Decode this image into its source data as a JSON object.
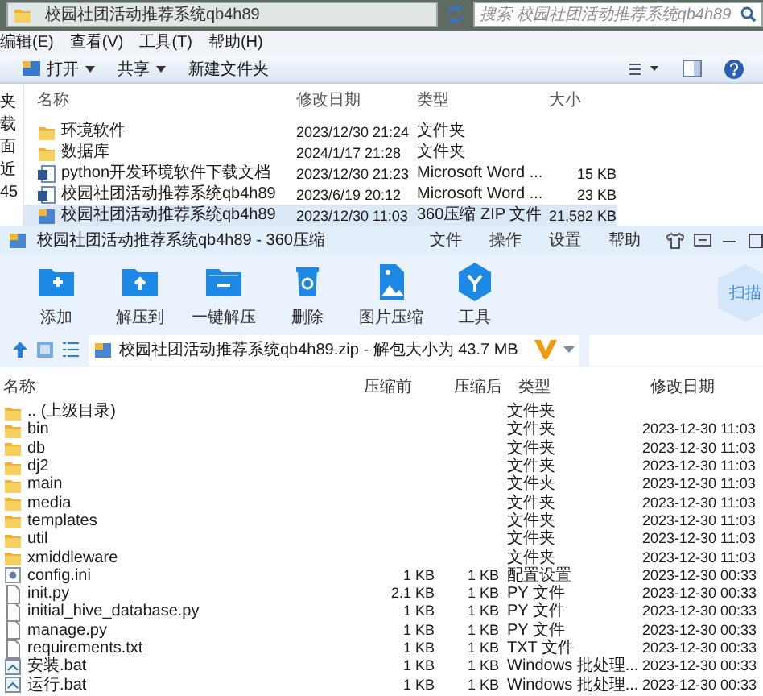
{
  "explorer": {
    "address": {
      "path": "校园社团活动推荐系统qb4h89"
    },
    "search": {
      "placeholder": "搜索 校园社团活动推荐系统qb4h89"
    },
    "menu": [
      "编辑(E)",
      "查看(V)",
      "工具(T)",
      "帮助(H)"
    ],
    "toolbar": [
      {
        "label": "打开",
        "kind": "open"
      },
      {
        "label": "共享",
        "kind": "dropdown"
      },
      {
        "label": "新建文件夹",
        "kind": "plain"
      }
    ],
    "sidebar": [
      "夹",
      "载",
      "面",
      "近",
      "45"
    ],
    "columns": [
      "名称",
      "修改日期",
      "类型",
      "大小"
    ],
    "rows": [
      {
        "name": "环境软件",
        "date": "2023/12/30 21:24",
        "type": "文件夹",
        "size": "",
        "kind": "folder",
        "selected": false
      },
      {
        "name": "数据库",
        "date": "2024/1/17 21:28",
        "type": "文件夹",
        "size": "",
        "kind": "folder",
        "selected": false
      },
      {
        "name": "python开发环境软件下载文档",
        "date": "2023/12/30 21:23",
        "type": "Microsoft Word ...",
        "size": "15 KB",
        "kind": "word",
        "selected": false
      },
      {
        "name": "校园社团活动推荐系统qb4h89",
        "date": "2023/6/19 20:12",
        "type": "Microsoft Word ...",
        "size": "23 KB",
        "kind": "word",
        "selected": false
      },
      {
        "name": "校园社团活动推荐系统qb4h89",
        "date": "2023/12/30 11:03",
        "type": "360压缩 ZIP 文件",
        "size": "21,582 KB",
        "kind": "zip",
        "selected": true
      }
    ]
  },
  "zip": {
    "title": "校园社团活动推荐系统qb4h89 - 360压缩",
    "menu": [
      "文件",
      "操作",
      "设置",
      "帮助"
    ],
    "tools": [
      {
        "label": "添加",
        "kind": "add"
      },
      {
        "label": "解压到",
        "kind": "extract"
      },
      {
        "label": "一键解压",
        "kind": "oneclick"
      },
      {
        "label": "删除",
        "kind": "delete"
      },
      {
        "label": "图片压缩",
        "kind": "image"
      },
      {
        "label": "工具",
        "kind": "tools"
      }
    ],
    "scan": "扫描",
    "path": "校园社团活动推荐系统qb4h89.zip - 解包大小为 43.7 MB",
    "columns": [
      "名称",
      "压缩前",
      "压缩后",
      "类型",
      "修改日期"
    ],
    "rows": [
      {
        "name": ".. (上级目录)",
        "before": "",
        "after": "",
        "type": "文件夹",
        "date": "",
        "kind": "folder"
      },
      {
        "name": "bin",
        "before": "",
        "after": "",
        "type": "文件夹",
        "date": "2023-12-30 11:03",
        "kind": "folder"
      },
      {
        "name": "db",
        "before": "",
        "after": "",
        "type": "文件夹",
        "date": "2023-12-30 11:03",
        "kind": "folder"
      },
      {
        "name": "dj2",
        "before": "",
        "after": "",
        "type": "文件夹",
        "date": "2023-12-30 11:03",
        "kind": "folder"
      },
      {
        "name": "main",
        "before": "",
        "after": "",
        "type": "文件夹",
        "date": "2023-12-30 11:03",
        "kind": "folder"
      },
      {
        "name": "media",
        "before": "",
        "after": "",
        "type": "文件夹",
        "date": "2023-12-30 11:03",
        "kind": "folder"
      },
      {
        "name": "templates",
        "before": "",
        "after": "",
        "type": "文件夹",
        "date": "2023-12-30 11:03",
        "kind": "folder"
      },
      {
        "name": "util",
        "before": "",
        "after": "",
        "type": "文件夹",
        "date": "2023-12-30 11:03",
        "kind": "folder"
      },
      {
        "name": "xmiddleware",
        "before": "",
        "after": "",
        "type": "文件夹",
        "date": "2023-12-30 11:03",
        "kind": "folder"
      },
      {
        "name": "config.ini",
        "before": "1 KB",
        "after": "1 KB",
        "type": "配置设置",
        "date": "2023-12-30 00:33",
        "kind": "ini"
      },
      {
        "name": "init.py",
        "before": "2.1 KB",
        "after": "1 KB",
        "type": "PY 文件",
        "date": "2023-12-30 00:33",
        "kind": "file"
      },
      {
        "name": "initial_hive_database.py",
        "before": "1 KB",
        "after": "1 KB",
        "type": "PY 文件",
        "date": "2023-12-30 00:33",
        "kind": "file"
      },
      {
        "name": "manage.py",
        "before": "1 KB",
        "after": "1 KB",
        "type": "PY 文件",
        "date": "2023-12-30 00:33",
        "kind": "file"
      },
      {
        "name": "requirements.txt",
        "before": "1 KB",
        "after": "1 KB",
        "type": "TXT 文件",
        "date": "2023-12-30 00:33",
        "kind": "file"
      },
      {
        "name": "安装.bat",
        "before": "1 KB",
        "after": "1 KB",
        "type": "Windows 批处理...",
        "date": "2023-12-30 00:33",
        "kind": "bat"
      },
      {
        "name": "运行.bat",
        "before": "1 KB",
        "after": "1 KB",
        "type": "Windows 批处理...",
        "date": "2023-12-30 00:33",
        "kind": "bat"
      }
    ]
  }
}
